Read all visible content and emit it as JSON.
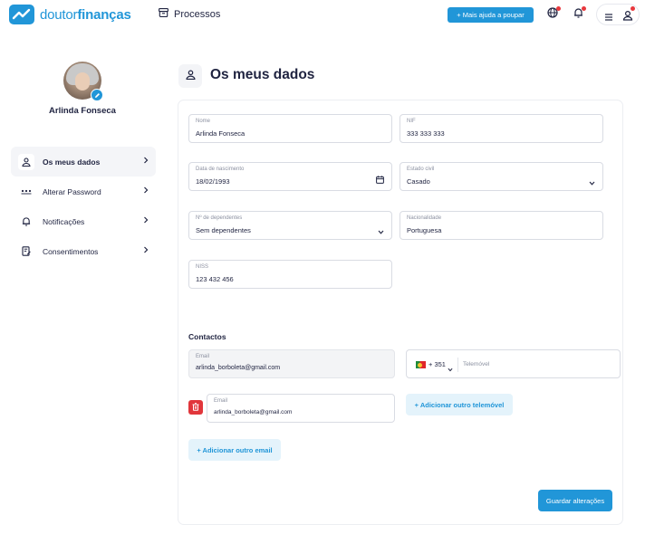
{
  "brand": {
    "name_light": "doutor",
    "name_bold": "finanças",
    "color": "#2196d8"
  },
  "header": {
    "processos_label": "Processos",
    "cta_label": "+ Mais ajuda a poupar",
    "icons": [
      "box-icon",
      "globe-icon",
      "bell-icon",
      "menu-icon",
      "user-icon"
    ],
    "notification_color": "#e8383d"
  },
  "profile": {
    "name": "Arlinda Fonseca"
  },
  "sidebar": {
    "items": [
      {
        "label": "Os meus dados",
        "icon": "user-icon",
        "active": true
      },
      {
        "label": "Alterar Password",
        "icon": "password-dots-icon",
        "active": false
      },
      {
        "label": "Notificações",
        "icon": "bell-icon",
        "active": false
      },
      {
        "label": "Consentimentos",
        "icon": "document-edit-icon",
        "active": false
      }
    ]
  },
  "page": {
    "title": "Os meus dados"
  },
  "form": {
    "nome": {
      "label": "Nome",
      "value": "Arlinda Fonseca"
    },
    "nif": {
      "label": "NIF",
      "value": "333 333 333"
    },
    "data_nascimento": {
      "label": "Data de nascimento",
      "value": "18/02/1993"
    },
    "estado_civil": {
      "label": "Estado civil",
      "value": "Casado"
    },
    "dependentes": {
      "label": "Nº de dependentes",
      "value": "Sem dependentes"
    },
    "nacionalidade": {
      "label": "Nacionalidade",
      "value": "Portuguesa"
    },
    "niss": {
      "label": "NISS",
      "value": "123 432 456"
    }
  },
  "contactos": {
    "title": "Contactos",
    "email_primary": {
      "label": "Email",
      "value": "arlinda_borboleta@gmail.com"
    },
    "phone": {
      "country_code": "+ 351",
      "placeholder": "Telemóvel"
    },
    "email_secondary": {
      "label": "Email",
      "value": "arlinda_borboleta@gmail.com"
    },
    "add_phone_label": "+ Adicionar outro telemóvel",
    "add_email_label": "+ Adicionar outro email"
  },
  "save_label": "Guardar alterações"
}
